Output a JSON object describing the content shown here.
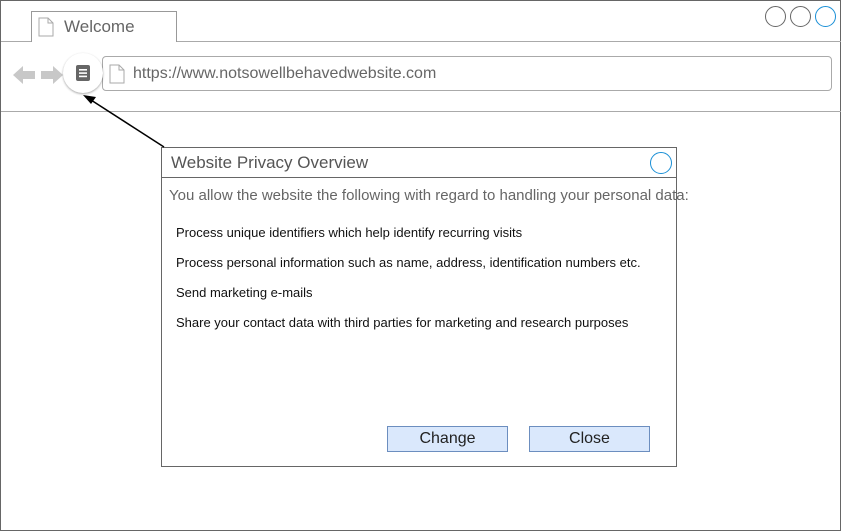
{
  "tab": {
    "label": "Welcome"
  },
  "address_bar": {
    "url": "https://www.notsowellbehavedwebsite.com"
  },
  "dialog": {
    "title": "Website Privacy Overview",
    "intro": "You allow the website the following with regard to handling your personal data:",
    "permissions": [
      "Process unique identifiers which help identify recurring visits",
      "Process personal information such as name, address, identification numbers etc.",
      "Send marketing e-mails",
      "Share your contact data with third parties for marketing and research purposes"
    ],
    "buttons": {
      "change": "Change",
      "close": "Close"
    }
  },
  "icons": {
    "tab_page": "page-icon",
    "back": "arrow-left-icon",
    "forward": "arrow-right-icon",
    "site_info": "document-icon",
    "url_page": "page-icon"
  },
  "colors": {
    "accent": "#1a8fd6",
    "button_fill": "#dae8fc",
    "button_border": "#6c8ebf",
    "disabled_nav": "#c8c8c8"
  }
}
